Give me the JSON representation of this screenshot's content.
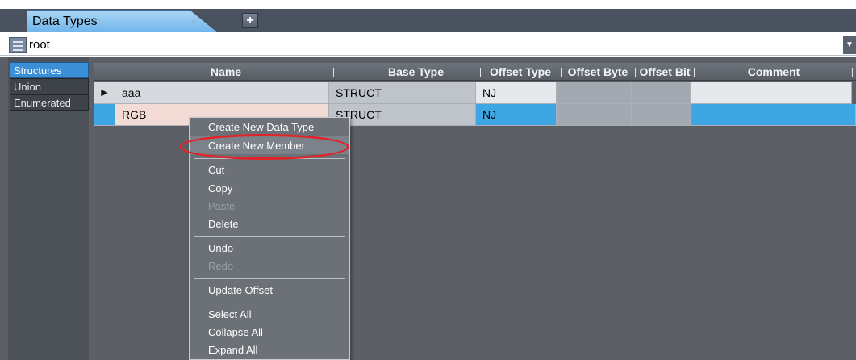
{
  "tab": {
    "title": "Data Types",
    "close_glyph": "×",
    "add_glyph": "+"
  },
  "breadcrumb": {
    "icon": "tree-view-icon",
    "path": "root",
    "dropdown_glyph": "▼"
  },
  "sidebar": {
    "items": [
      {
        "label": "Structures",
        "selected": true
      },
      {
        "label": "Union",
        "selected": false
      },
      {
        "label": "Enumerated",
        "selected": false
      }
    ]
  },
  "grid": {
    "columns": [
      "Name",
      "Base Type",
      "Offset Type",
      "Offset Byte",
      "Offset Bit",
      "Comment"
    ],
    "rows": [
      {
        "marker": "▶",
        "name": "aaa",
        "base_type": "STRUCT",
        "offset_type": "NJ",
        "offset_byte": "",
        "offset_bit": "",
        "comment": ""
      },
      {
        "marker": "",
        "name": "RGB",
        "base_type": "STRUCT",
        "offset_type": "NJ",
        "offset_byte": "",
        "offset_bit": "",
        "comment": ""
      }
    ]
  },
  "context_menu": {
    "items": [
      {
        "label": "Create New Data Type",
        "enabled": true
      },
      {
        "label": "Create New Member",
        "enabled": true,
        "highlighted": true
      },
      {
        "label": "Cut",
        "enabled": true
      },
      {
        "label": "Copy",
        "enabled": true
      },
      {
        "label": "Paste",
        "enabled": false
      },
      {
        "label": "Delete",
        "enabled": true
      },
      {
        "label": "Undo",
        "enabled": true
      },
      {
        "label": "Redo",
        "enabled": false
      },
      {
        "label": "Update Offset",
        "enabled": true
      },
      {
        "label": "Select All",
        "enabled": true
      },
      {
        "label": "Collapse All",
        "enabled": true
      },
      {
        "label": "Expand All",
        "enabled": true
      }
    ]
  },
  "colors": {
    "tab_active": "#6fb6ea",
    "row_selected": "#3fa6e4",
    "annotation_oval": "#e2232a"
  }
}
